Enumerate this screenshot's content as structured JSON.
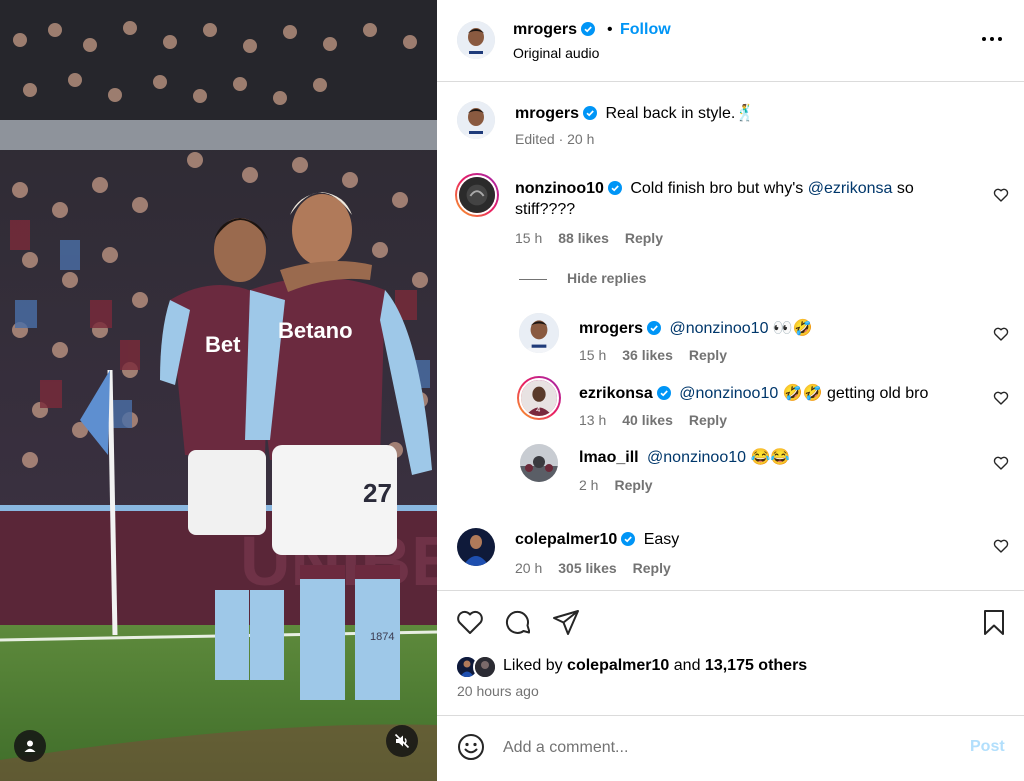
{
  "header": {
    "username": "mrogers",
    "separator": "•",
    "follow_label": "Follow",
    "audio": "Original audio"
  },
  "caption": {
    "username": "mrogers",
    "text": "Real back in style.🕺",
    "meta": "Edited · 20 h"
  },
  "comments": [
    {
      "username": "nonzinoo10",
      "text_before": "Cold finish bro but why's ",
      "mention": "@ezrikonsa",
      "text_after": " so",
      "text_line2": "stiff????",
      "time": "15 h",
      "likes": "88 likes",
      "reply": "Reply"
    }
  ],
  "hide_replies": "Hide replies",
  "replies": [
    {
      "username": "mrogers",
      "mention": "@nonzinoo10",
      "text": " 👀🤣",
      "time": "15 h",
      "likes": "36 likes",
      "reply": "Reply"
    },
    {
      "username": "ezrikonsa",
      "mention": "@nonzinoo10",
      "text": " 🤣🤣 getting old bro",
      "time": "13 h",
      "likes": "40 likes",
      "reply": "Reply"
    },
    {
      "username": "lmao_ill",
      "mention": "@nonzinoo10",
      "text": " 😂😂",
      "time": "2 h",
      "reply": "Reply"
    }
  ],
  "comment2": {
    "username": "colepalmer10",
    "text": "Easy",
    "time": "20 h",
    "likes": "305 likes",
    "reply": "Reply"
  },
  "liked_by": {
    "prefix": "Liked by ",
    "user": "colepalmer10",
    "middle": " and ",
    "others": "13,175 others"
  },
  "time_ago": "20 hours ago",
  "comment_box": {
    "placeholder": "Add a comment...",
    "post_label": "Post"
  },
  "media": {
    "jersey_text": "Betano",
    "jersey_number": "27",
    "shorts_text": "1874"
  },
  "icons": {
    "verified": "verified-badge-icon",
    "more": "more-options-icon",
    "heart": "heart-icon",
    "comment": "comment-icon",
    "share": "share-icon",
    "save": "bookmark-icon",
    "emoji": "emoji-icon",
    "mute": "muted-speaker-icon",
    "tags": "user-tag-icon"
  },
  "colors": {
    "link_blue": "#0095f6",
    "mention_blue": "#00376b",
    "muted_text": "#737373",
    "verified_blue": "#0095f6",
    "post_disabled": "#b2dffc",
    "claret": "#6b2a3f",
    "villa_blue": "#9ec8e8"
  }
}
